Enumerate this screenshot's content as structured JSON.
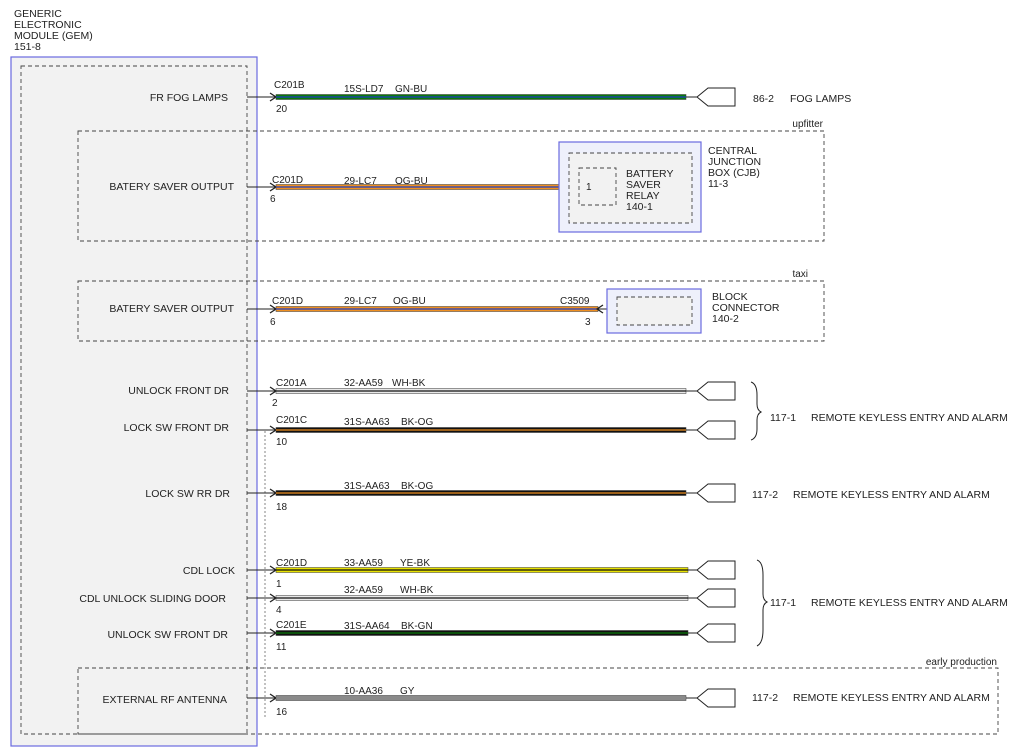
{
  "module": {
    "line1": "GENERIC",
    "line2": "ELECTRONIC",
    "line3": "MODULE (GEM)",
    "line4": "151-8"
  },
  "groups": {
    "upfitter": "upfitter",
    "taxi": "taxi",
    "early_production": "early production"
  },
  "circuits": [
    {
      "label": "FR FOG LAMPS",
      "connector": "C201B",
      "pin": "20",
      "wire": "15S-LD7",
      "color_code": "GN-BU"
    },
    {
      "label": "BATERY SAVER OUTPUT",
      "connector": "C201D",
      "pin": "6",
      "wire": "29-LC7",
      "color_code": "OG-BU"
    },
    {
      "label": "BATERY SAVER OUTPUT",
      "connector": "C201D",
      "pin": "6",
      "wire": "29-LC7",
      "color_code": "OG-BU"
    },
    {
      "label": "UNLOCK FRONT DR",
      "connector": "C201A",
      "pin": "2",
      "wire": "32-AA59",
      "color_code": "WH-BK"
    },
    {
      "label": "LOCK SW FRONT DR",
      "connector": "C201C",
      "pin": "10",
      "wire": "31S-AA63",
      "color_code": "BK-OG"
    },
    {
      "label": "LOCK SW RR DR",
      "connector": "",
      "pin": "18",
      "wire": "31S-AA63",
      "color_code": "BK-OG"
    },
    {
      "label": "CDL LOCK",
      "connector": "C201D",
      "pin": "1",
      "wire": "33-AA59",
      "color_code": "YE-BK"
    },
    {
      "label": "CDL UNLOCK SLIDING DOOR",
      "connector": "",
      "pin": "4",
      "wire": "32-AA59",
      "color_code": "WH-BK"
    },
    {
      "label": "UNLOCK SW FRONT DR",
      "connector": "C201E",
      "pin": "11",
      "wire": "31S-AA64",
      "color_code": "BK-GN"
    },
    {
      "label": "EXTERNAL RF ANTENNA",
      "connector": "",
      "pin": "16",
      "wire": "10-AA36",
      "color_code": "GY"
    }
  ],
  "destinations": {
    "fog": {
      "ref": "86-2",
      "name": "FOG LAMPS"
    },
    "cjb": {
      "line1": "CENTRAL",
      "line2": "JUNCTION",
      "line3": "BOX (CJB)",
      "line4": "11-3"
    },
    "relay": {
      "pin": "1",
      "line1": "BATTERY",
      "line2": "SAVER",
      "line3": "RELAY",
      "line4": "140-1"
    },
    "block": {
      "line1": "BLOCK",
      "line2": "CONNECTOR",
      "line3": "140-2",
      "connector": "C3509",
      "pin": "3"
    },
    "rke_a": {
      "ref": "117-1",
      "name": "REMOTE KEYLESS ENTRY AND ALARM"
    },
    "rke_b": {
      "ref": "117-2",
      "name": "REMOTE KEYLESS ENTRY AND ALARM"
    },
    "rke_c": {
      "ref": "117-1",
      "name": "REMOTE KEYLESS ENTRY AND ALARM"
    },
    "rke_d": {
      "ref": "117-2",
      "name": "REMOTE KEYLESS ENTRY AND ALARM"
    }
  },
  "colors": {
    "module_border": "#6a6ae0",
    "module_fill": "#f2f2f2",
    "dashed": "#444444",
    "green": "#0a7a0a",
    "blue": "#1f3fc4",
    "orange": "#f09020",
    "white": "#e8e8e8",
    "black": "#111111",
    "yellow": "#e8e200",
    "gray": "#8a8a8a"
  }
}
